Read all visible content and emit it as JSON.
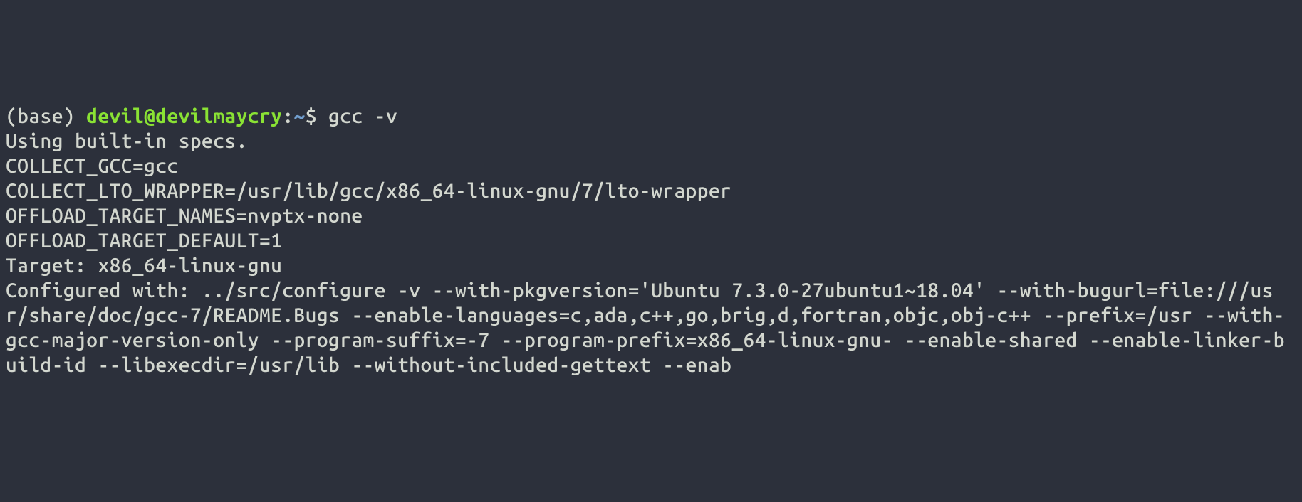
{
  "terminal": {
    "prompt": {
      "env": "(base) ",
      "user_host": "devil@devilmaycry",
      "colon": ":",
      "path": "~",
      "dollar": "$ ",
      "command": "gcc -v"
    },
    "output": "Using built-in specs.\nCOLLECT_GCC=gcc\nCOLLECT_LTO_WRAPPER=/usr/lib/gcc/x86_64-linux-gnu/7/lto-wrapper\nOFFLOAD_TARGET_NAMES=nvptx-none\nOFFLOAD_TARGET_DEFAULT=1\nTarget: x86_64-linux-gnu\nConfigured with: ../src/configure -v --with-pkgversion='Ubuntu 7.3.0-27ubuntu1~18.04' --with-bugurl=file:///usr/share/doc/gcc-7/README.Bugs --enable-languages=c,ada,c++,go,brig,d,fortran,objc,obj-c++ --prefix=/usr --with-gcc-major-version-only --program-suffix=-7 --program-prefix=x86_64-linux-gnu- --enable-shared --enable-linker-build-id --libexecdir=/usr/lib --without-included-gettext --enab"
  }
}
